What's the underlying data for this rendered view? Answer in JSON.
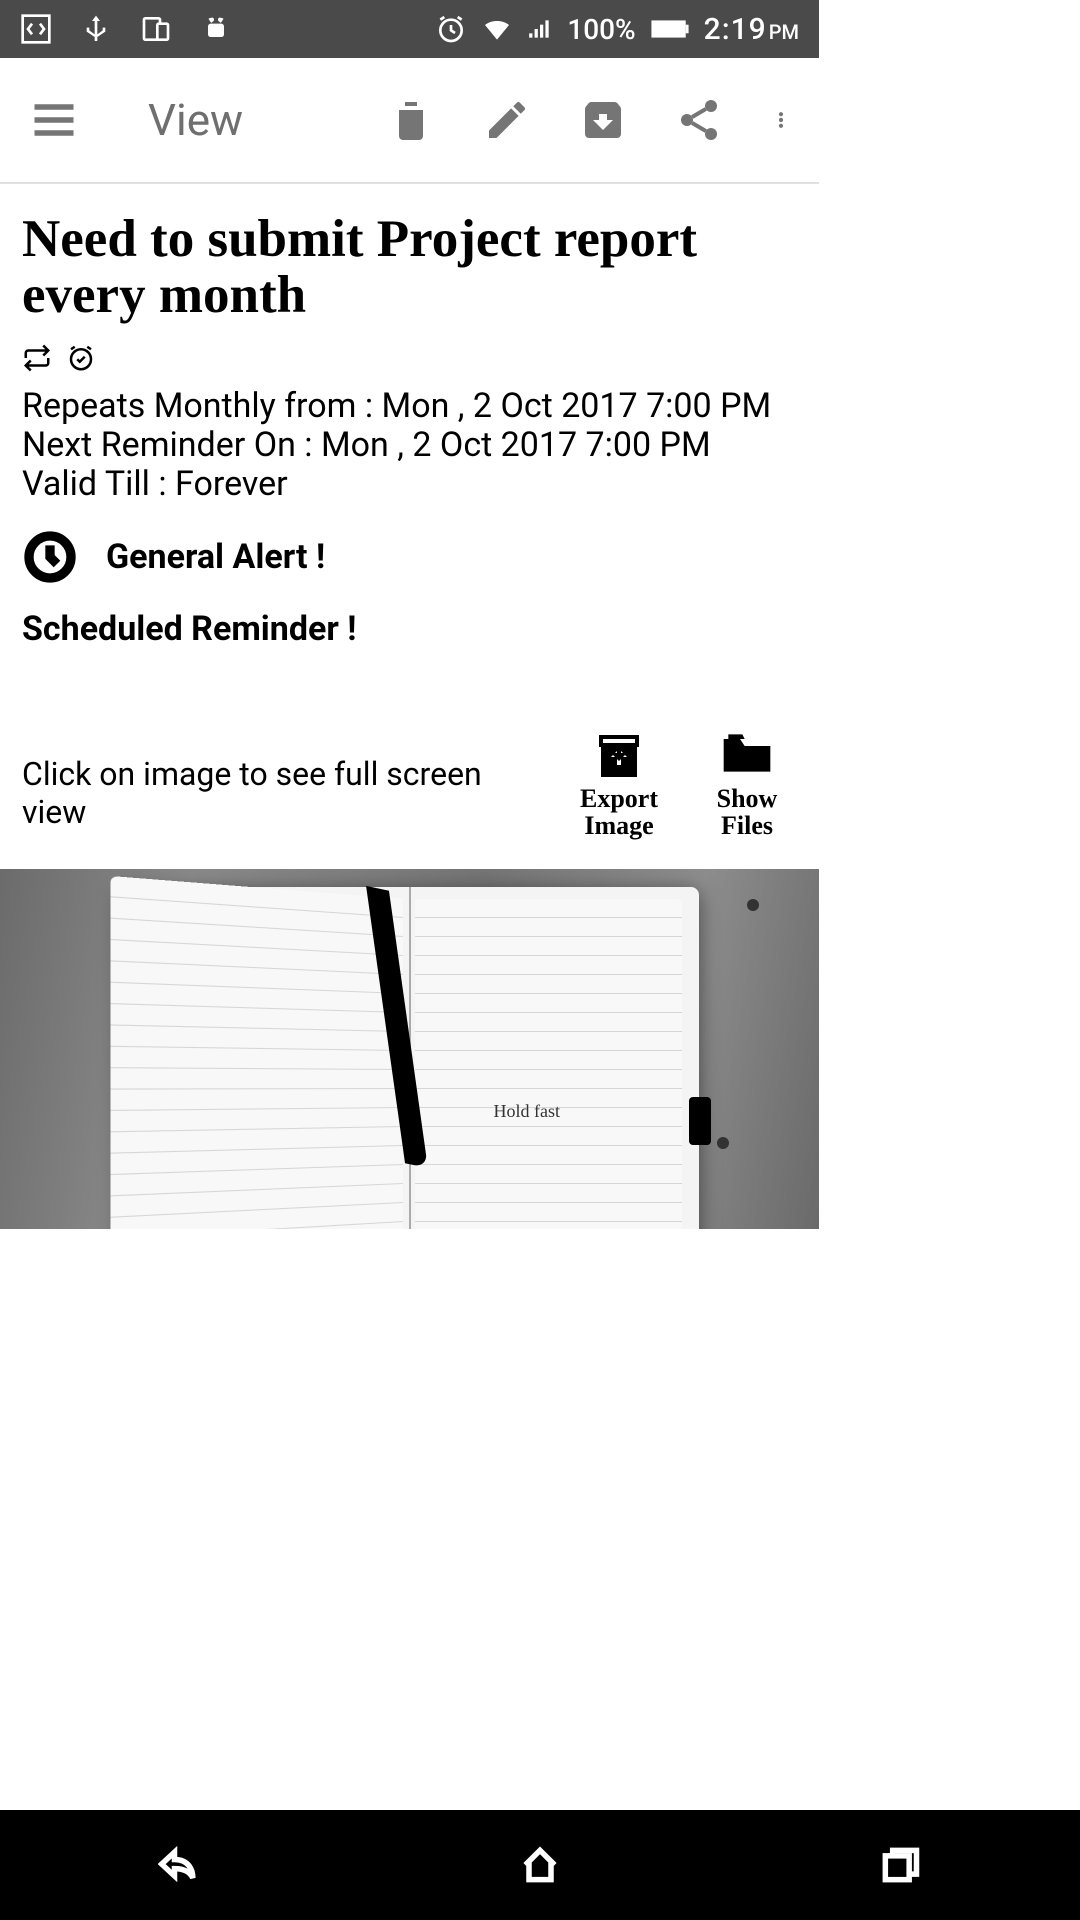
{
  "status_bar": {
    "battery_pct": "100%",
    "time": "2:19",
    "period": "PM"
  },
  "app_bar": {
    "title": "View"
  },
  "note": {
    "title": "Need to submit Project report every month",
    "repeats_line": "Repeats Monthly from : Mon , 2 Oct 2017 7:00 PM",
    "next_line": "Next Reminder On : Mon , 2 Oct 2017 7:00 PM",
    "valid_line": "Valid Till : Forever",
    "alert_label": "General Alert !",
    "scheduled_label": "Scheduled Reminder !",
    "image_hint": "Click on image to see full screen view",
    "image_caption": "Hold fast"
  },
  "actions": {
    "export_label": "Export Image",
    "show_files_label": "Show Files"
  }
}
